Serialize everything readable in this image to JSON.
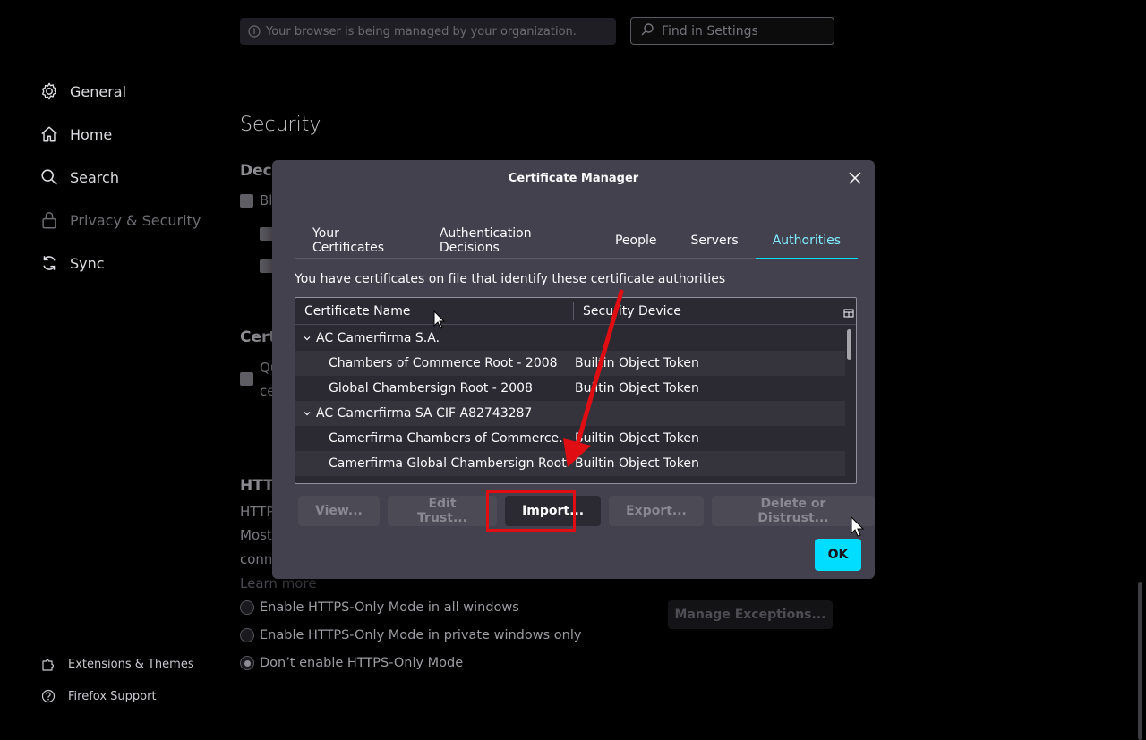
{
  "background": {
    "managed_banner": "Your browser is being managed by your organization.",
    "search_placeholder": "Find in Settings",
    "sidebar": [
      {
        "label": "General",
        "icon": "gear-icon"
      },
      {
        "label": "Home",
        "icon": "home-icon"
      },
      {
        "label": "Search",
        "icon": "search-icon"
      },
      {
        "label": "Privacy & Security",
        "icon": "lock-icon"
      },
      {
        "label": "Sync",
        "icon": "sync-icon"
      }
    ],
    "sidebar_bottom": [
      {
        "label": "Extensions & Themes",
        "icon": "puzzle-icon"
      },
      {
        "label": "Firefox Support",
        "icon": "help-icon"
      }
    ],
    "section_title": "Security",
    "partial_texts": {
      "dece": "Dece",
      "bl": "Bl",
      "cert": "Cert",
      "qu": "Qu",
      "ce": "ce",
      "http_heading": "HTTI",
      "http_line1": "HTTP",
      "http_line2": "Most",
      "http_line3": "conn",
      "learn_more": "Learn more"
    },
    "https_options": [
      {
        "label": "Enable HTTPS-Only Mode in all windows",
        "checked": false
      },
      {
        "label": "Enable HTTPS-Only Mode in private windows only",
        "checked": false
      },
      {
        "label": "Don’t enable HTTPS-Only Mode",
        "checked": true
      }
    ],
    "manage_exceptions": "Manage Exceptions..."
  },
  "dialog": {
    "title": "Certificate Manager",
    "tabs": [
      {
        "label": "Your Certificates",
        "active": false
      },
      {
        "label": "Authentication Decisions",
        "active": false
      },
      {
        "label": "People",
        "active": false
      },
      {
        "label": "Servers",
        "active": false
      },
      {
        "label": "Authorities",
        "active": true
      }
    ],
    "description": "You have certificates on file that identify these certificate authorities",
    "columns": [
      "Certificate Name",
      "Security Device"
    ],
    "rows": [
      {
        "type": "group",
        "name": "AC Camerfirma S.A.",
        "device": ""
      },
      {
        "type": "child",
        "name": "Chambers of Commerce Root - 2008",
        "device": "Builtin Object Token"
      },
      {
        "type": "child",
        "name": "Global Chambersign Root - 2008",
        "device": "Builtin Object Token"
      },
      {
        "type": "group",
        "name": "AC Camerfirma SA CIF A82743287",
        "device": ""
      },
      {
        "type": "child",
        "name": "Camerfirma Chambers of Commerce R...",
        "device": "Builtin Object Token"
      },
      {
        "type": "child",
        "name": "Camerfirma Global Chambersign Root",
        "device": "Builtin Object Token"
      }
    ],
    "buttons": {
      "view": "View...",
      "edit_trust": "Edit Trust...",
      "import": "Import...",
      "export": "Export...",
      "delete": "Delete or Distrust..."
    },
    "ok": "OK"
  },
  "colors": {
    "accent": "#00ddff",
    "annotation": "#e00e12"
  }
}
